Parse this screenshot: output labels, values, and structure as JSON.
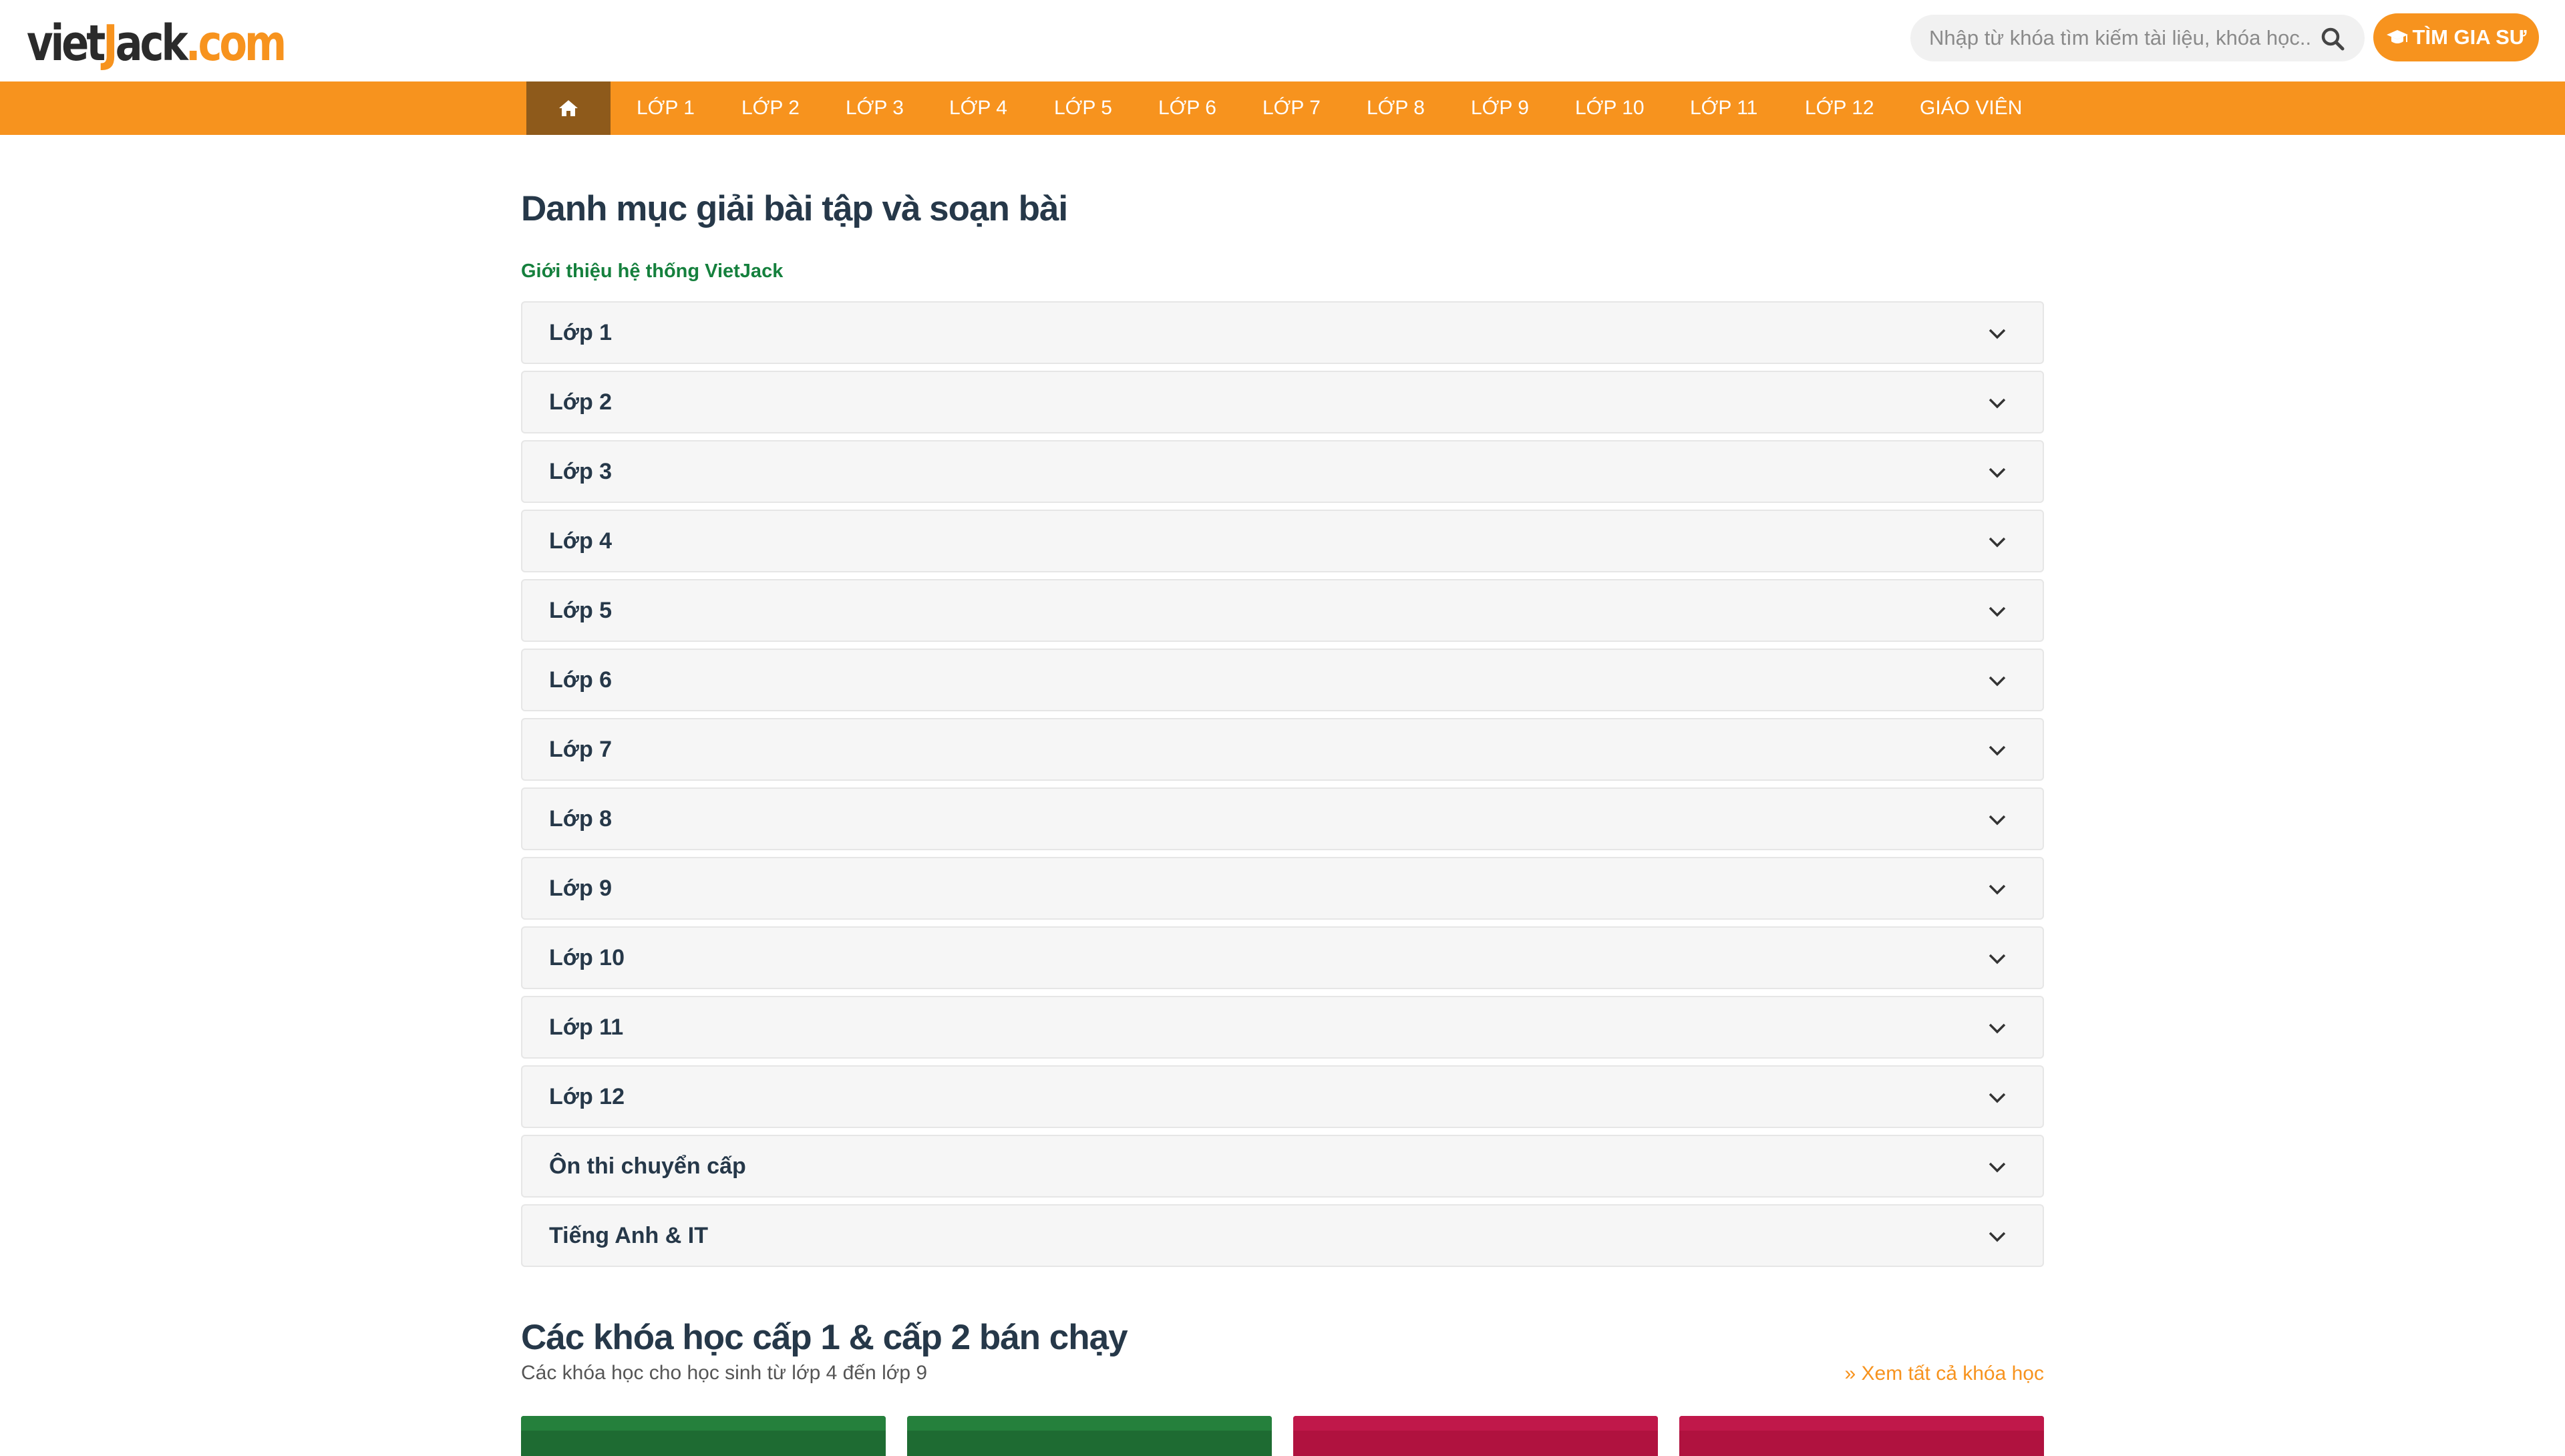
{
  "logo": {
    "viet": "viet",
    "j": "J",
    "ack": "ack",
    "dotcom": ".com"
  },
  "search": {
    "placeholder": "Nhập từ khóa tìm kiếm tài liệu, khóa học..."
  },
  "tutor_button": {
    "label": "TÌM GIA SƯ"
  },
  "nav": {
    "home_icon": "home-icon",
    "items": [
      "LỚP 1",
      "LỚP 2",
      "LỚP 3",
      "LỚP 4",
      "LỚP 5",
      "LỚP 6",
      "LỚP 7",
      "LỚP 8",
      "LỚP 9",
      "LỚP 10",
      "LỚP 11",
      "LỚP 12",
      "GIÁO VIÊN"
    ]
  },
  "main": {
    "title": "Danh mục giải bài tập và soạn bài",
    "intro_link": "Giới thiệu hệ thống VietJack",
    "accordion": [
      "Lớp 1",
      "Lớp 2",
      "Lớp 3",
      "Lớp 4",
      "Lớp 5",
      "Lớp 6",
      "Lớp 7",
      "Lớp 8",
      "Lớp 9",
      "Lớp 10",
      "Lớp 11",
      "Lớp 12",
      "Ôn thi chuyển cấp",
      "Tiếng Anh & IT"
    ]
  },
  "courses": {
    "title": "Các khóa học cấp 1 & cấp 2 bán chạy",
    "subtitle": "Các khóa học cho học sinh từ lớp 4 đến lớp 9",
    "see_all": "Xem tất cả khóa học"
  },
  "colors": {
    "brand_orange": "#f7931e",
    "nav_active": "#8e5a1b",
    "link_green": "#15803d",
    "card_green": "#1e6b32",
    "card_red": "#b0123f"
  }
}
